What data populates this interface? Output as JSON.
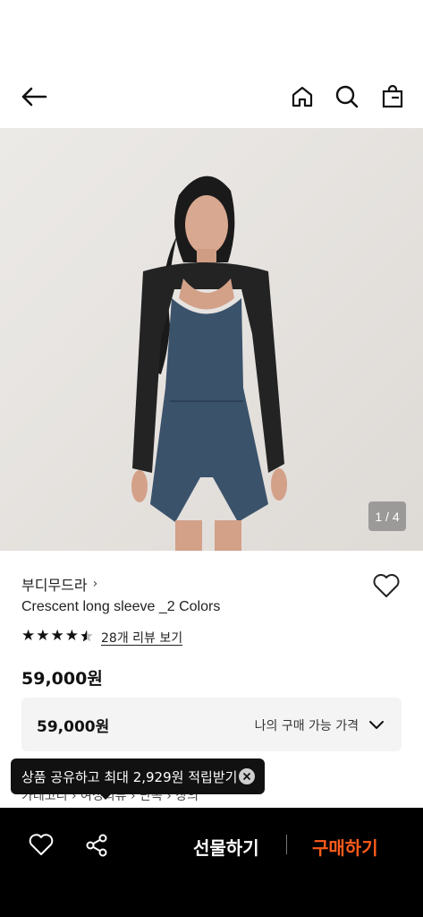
{
  "header": {
    "icons": [
      "back-arrow-icon",
      "home-icon",
      "search-icon",
      "shopping-bag-icon"
    ]
  },
  "gallery": {
    "counter": "1 / 4"
  },
  "product": {
    "brand": "부디무드라",
    "brand_chevron": "›",
    "title": "Crescent long sleeve _2 Colors",
    "rating": 4.5,
    "reviews_link": "28개 리뷰 보기",
    "price": "59,000원"
  },
  "price_box": {
    "value": "59,000원",
    "label": "나의 구매 가능 가격"
  },
  "breadcrumb": {
    "text": "카테고리  ›  여성의류  ›  단독  ›  상의"
  },
  "tooltip": {
    "text": "상품 공유하고 최대 2,929원 적립받기"
  },
  "bottom_bar": {
    "gift_label": "선물하기",
    "buy_label": "구매하기",
    "buy_color": "#ff5b1a"
  }
}
